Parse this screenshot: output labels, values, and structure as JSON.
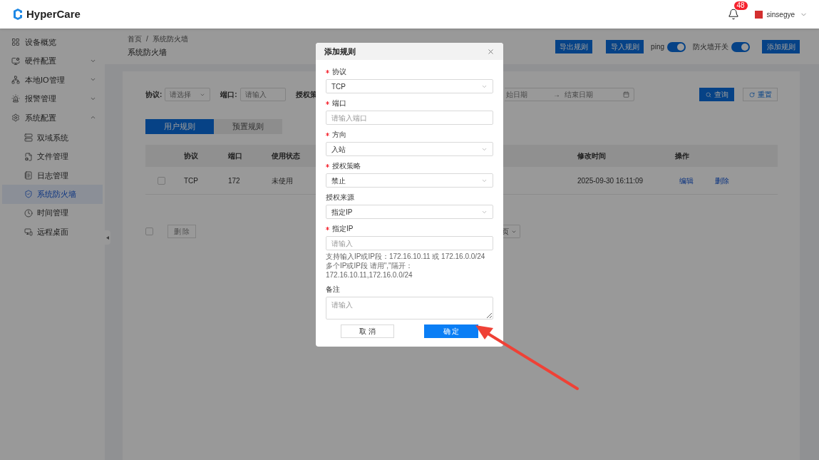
{
  "header": {
    "logo": "HyperCare",
    "notifications": "48",
    "user": "sinsegye"
  },
  "sidebar": {
    "items": [
      {
        "label": "设备概览",
        "kind": "link"
      },
      {
        "label": "硬件配置",
        "kind": "group",
        "expanded": false
      },
      {
        "label": "本地IO管理",
        "kind": "group",
        "expanded": false
      },
      {
        "label": "报警管理",
        "kind": "group",
        "expanded": false
      },
      {
        "label": "系统配置",
        "kind": "group",
        "expanded": true,
        "children": [
          {
            "label": "双域系统",
            "selected": false
          },
          {
            "label": "文件管理",
            "selected": false
          },
          {
            "label": "日志管理",
            "selected": false
          },
          {
            "label": "系统防火墙",
            "selected": true
          },
          {
            "label": "时间管理",
            "selected": false
          },
          {
            "label": "远程桌面",
            "selected": false
          }
        ]
      }
    ]
  },
  "breadcrumb": {
    "items": [
      "首页",
      "系统防火墙"
    ],
    "separator": "/"
  },
  "page_title": "系统防火墙",
  "toolbar": {
    "export": "导出规则",
    "import": "导入规则",
    "toggles": [
      {
        "label": "ping",
        "on": true
      },
      {
        "label": "防火墙开关",
        "on": true
      }
    ],
    "add": "添加规则"
  },
  "filters": {
    "protocol_label": "协议:",
    "protocol_placeholder": "请选择",
    "port_label": "端口:",
    "port_placeholder": "请输入",
    "policy_label": "授权策",
    "start_placeholder": "始日期",
    "range_separator": "→",
    "end_placeholder": "结束日期",
    "search": "查询",
    "reset": "重置"
  },
  "tabs": [
    {
      "label": "用户规则",
      "selected": true
    },
    {
      "label": "预置规则",
      "selected": false
    }
  ],
  "table": {
    "columns": [
      "协议",
      "端口",
      "使用状态",
      "修改时间",
      "操作"
    ],
    "rows": [
      {
        "checked": false,
        "cells": [
          "TCP",
          "172",
          "未使用",
          "2025-09-30 16:11:09"
        ],
        "actions": [
          "编辑",
          "删除"
        ]
      }
    ]
  },
  "footer": {
    "select_all_checked": false,
    "delete": "删 除",
    "page_size": "页"
  },
  "dialog": {
    "title": "添加规则",
    "fields": [
      {
        "kind": "select",
        "label": "协议",
        "required": true,
        "value": "TCP"
      },
      {
        "kind": "input",
        "label": "端口",
        "required": true,
        "placeholder": "请输入端口"
      },
      {
        "kind": "select",
        "label": "方向",
        "required": true,
        "value": "入站"
      },
      {
        "kind": "select",
        "label": "授权策略",
        "required": true,
        "value": "禁止"
      },
      {
        "kind": "select",
        "label": "授权来源",
        "required": false,
        "value": "指定IP"
      },
      {
        "kind": "input",
        "label": "指定IP",
        "required": true,
        "placeholder": "请输入",
        "hints": [
          "支持输入IP或IP段：172.16.10.11 或 172.16.0.0/24",
          "多个IP或IP段 请用\",\"隔开：172.16.10.11,172.16.0.0/24"
        ]
      },
      {
        "kind": "textarea",
        "label": "备注",
        "required": false,
        "placeholder": "请输入"
      }
    ],
    "cancel": "取 消",
    "confirm": "确 定"
  }
}
